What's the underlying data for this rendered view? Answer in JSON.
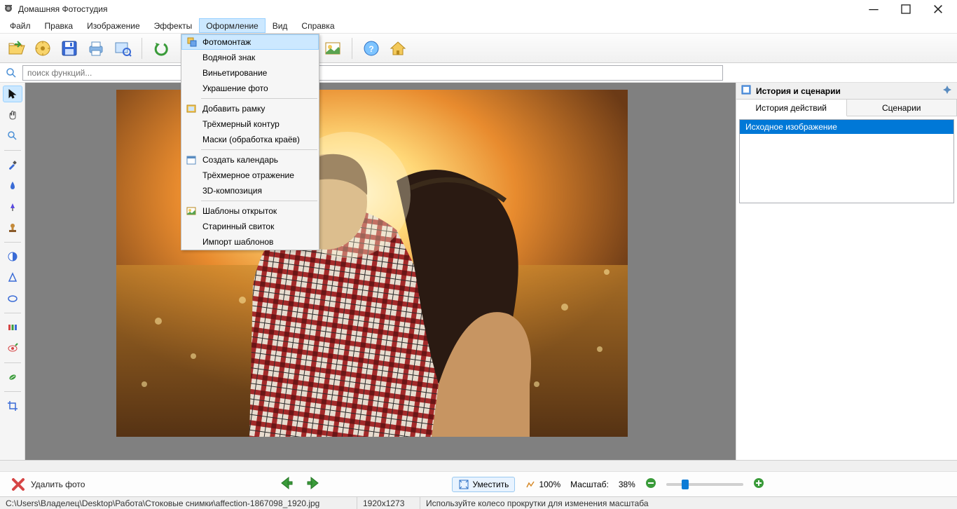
{
  "window": {
    "title": "Домашняя Фотостудия"
  },
  "menu": {
    "items": [
      "Файл",
      "Правка",
      "Изображение",
      "Эффекты",
      "Оформление",
      "Вид",
      "Справка"
    ],
    "open_index": 4
  },
  "dropdown": {
    "groups": [
      [
        "Фотомонтаж",
        "Водяной знак",
        "Виньетирование",
        "Украшение фото"
      ],
      [
        "Добавить рамку",
        "Трёхмерный контур",
        "Маски (обработка краёв)"
      ],
      [
        "Создать календарь",
        "Трёхмерное отражение",
        "3D-композиция"
      ],
      [
        "Шаблоны открыток",
        "Старинный свиток",
        "Импорт шаблонов"
      ]
    ],
    "highlighted": "Фотомонтаж"
  },
  "search": {
    "placeholder": "поиск функций..."
  },
  "right": {
    "title": "История и сценарии",
    "tabs": [
      "История действий",
      "Сценарии"
    ],
    "active_tab": 0,
    "history": [
      "Исходное изображение"
    ]
  },
  "bottom": {
    "delete": "Удалить фото",
    "fit": "Уместить",
    "percent": "100%",
    "scale_label": "Масштаб:",
    "scale_value": "38%"
  },
  "status": {
    "path": "C:\\Users\\Владелец\\Desktop\\Работа\\Стоковые снимки\\affection-1867098_1920.jpg",
    "dims": "1920x1273",
    "hint": "Используйте колесо прокрутки для изменения масштаба"
  }
}
